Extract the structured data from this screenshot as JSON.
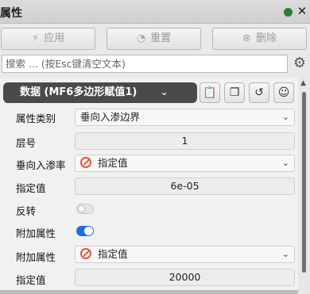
{
  "title": "属性",
  "toolbar": {
    "apply_label": "应用",
    "reset_label": "重置",
    "delete_label": "删除"
  },
  "search": {
    "placeholder": "搜索 ... (按Esc键清空文本)"
  },
  "dataset": {
    "label": "数据 (MF6多边形赋值1)"
  },
  "properties": {
    "category_label": "属性类别",
    "category_value": "垂向入渗边界",
    "layer_label": "层号",
    "layer_value": "1",
    "infiltration_label": "垂向入渗率",
    "infiltration_mode": "指定值",
    "specified1_label": "指定值",
    "specified1_value": "6e-05",
    "reverse_label": "反转",
    "additional1_label": "附加属性",
    "additional2_label": "附加属性",
    "additional2_mode": "指定值",
    "specified2_label": "指定值",
    "specified2_value": "20000"
  },
  "icons": {
    "apply": "lightning-icon",
    "reset": "gauge-icon",
    "delete": "x-circle-icon",
    "settings": "gear-icon"
  }
}
